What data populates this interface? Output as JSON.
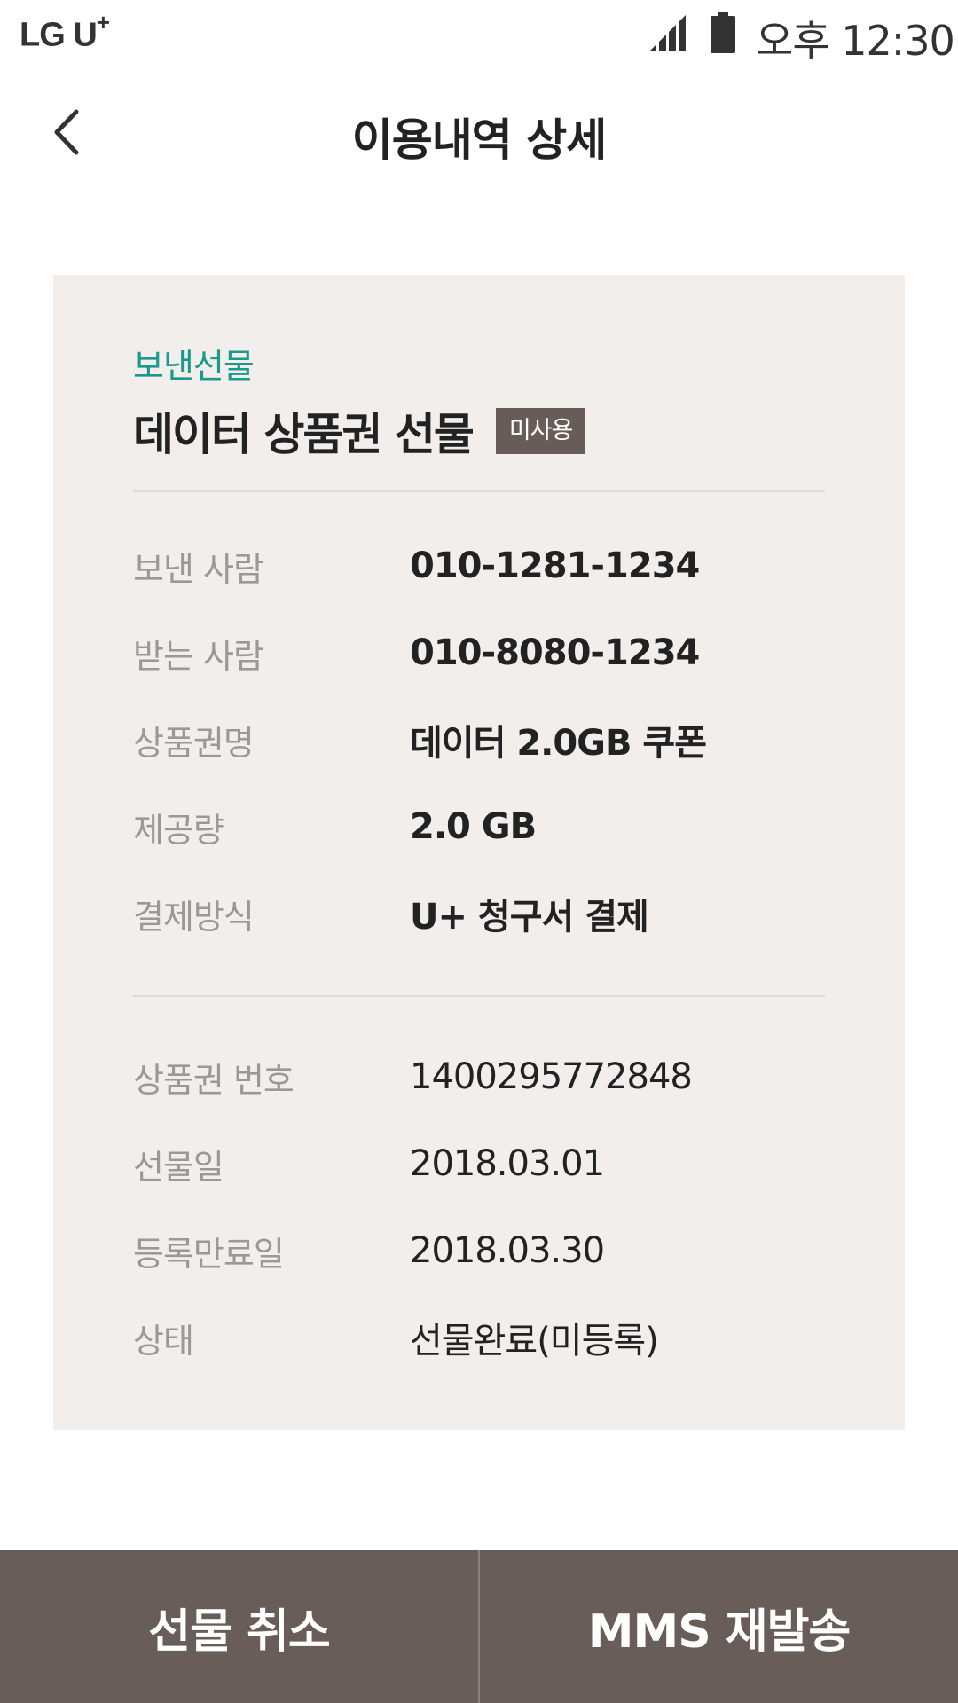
{
  "status_bar": {
    "carrier": "LG U",
    "carrier_sup": "+",
    "time": "오후 12:30",
    "icons": [
      "signal-icon",
      "battery-icon"
    ]
  },
  "header": {
    "back_icon": "chevron-left-icon",
    "title": "이용내역 상세"
  },
  "card": {
    "category": "보낸선물",
    "product_title": "데이터 상품권 선물",
    "status_badge": "미사용",
    "details": [
      {
        "label": "보낸 사람",
        "value": "010-1281-1234"
      },
      {
        "label": "받는 사람",
        "value": "010-8080-1234"
      },
      {
        "label": "상품권명",
        "value": "데이터 2.0GB 쿠폰"
      },
      {
        "label": "제공량",
        "value": "2.0 GB"
      },
      {
        "label": "결제방식",
        "value": "U+ 청구서 결제"
      }
    ],
    "info": [
      {
        "label": "상품권 번호",
        "value": "1400295772848"
      },
      {
        "label": "선물일",
        "value": "2018.03.01"
      },
      {
        "label": "등록만료일",
        "value": "2018.03.30"
      },
      {
        "label": "상태",
        "value": "선물완료(미등록)"
      }
    ]
  },
  "actions": {
    "cancel_gift": "선물 취소",
    "resend_mms": "MMS 재발송"
  },
  "colors": {
    "accent_teal": "#1b9a8c",
    "card_background": "#f1eeeb",
    "badge_background": "#675c58",
    "bottom_bar": "#685d59"
  }
}
